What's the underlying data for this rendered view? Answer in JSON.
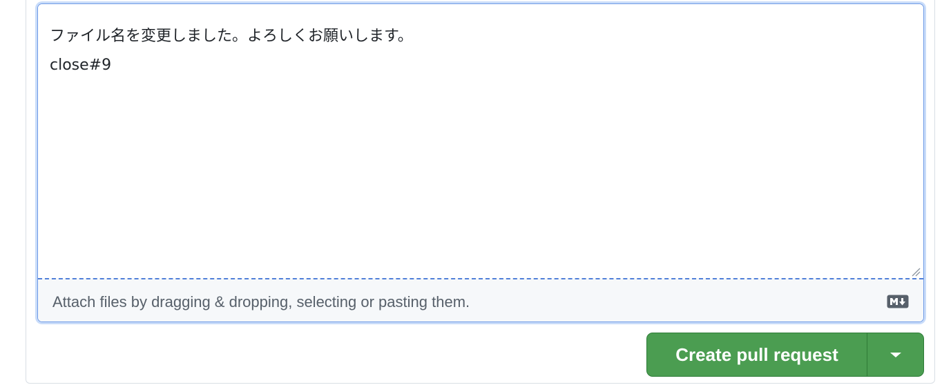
{
  "comment": {
    "lines": [
      "ファイル名を変更しました。よろしくお願いします。",
      "close#9"
    ]
  },
  "attach": {
    "hint": "Attach files by dragging & dropping, selecting or pasting them."
  },
  "icons": {
    "markdown": "markdown-icon",
    "resize": "resize-grip-icon",
    "dropdown": "chevron-down-icon"
  },
  "actions": {
    "create_pull_request": "Create pull request"
  },
  "colors": {
    "accent_green": "#4b9d51",
    "focus_blue": "#6e9ae6"
  }
}
